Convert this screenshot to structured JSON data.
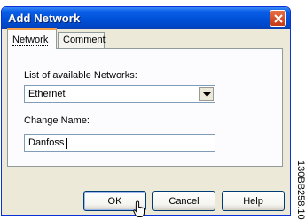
{
  "window": {
    "title": "Add Network",
    "titlebar_color": "#0050d8",
    "close_icon": "close-icon"
  },
  "tabs": [
    {
      "label": "Network",
      "selected": true
    },
    {
      "label": "Comment",
      "selected": false
    }
  ],
  "network_tab": {
    "list_label": "List of available Networks:",
    "selected_network": "Ethernet",
    "change_name_label": "Change Name:",
    "name_value": "Danfoss"
  },
  "buttons": {
    "ok": "OK",
    "cancel": "Cancel",
    "help": "Help"
  },
  "figure_id": "130BB258.10"
}
